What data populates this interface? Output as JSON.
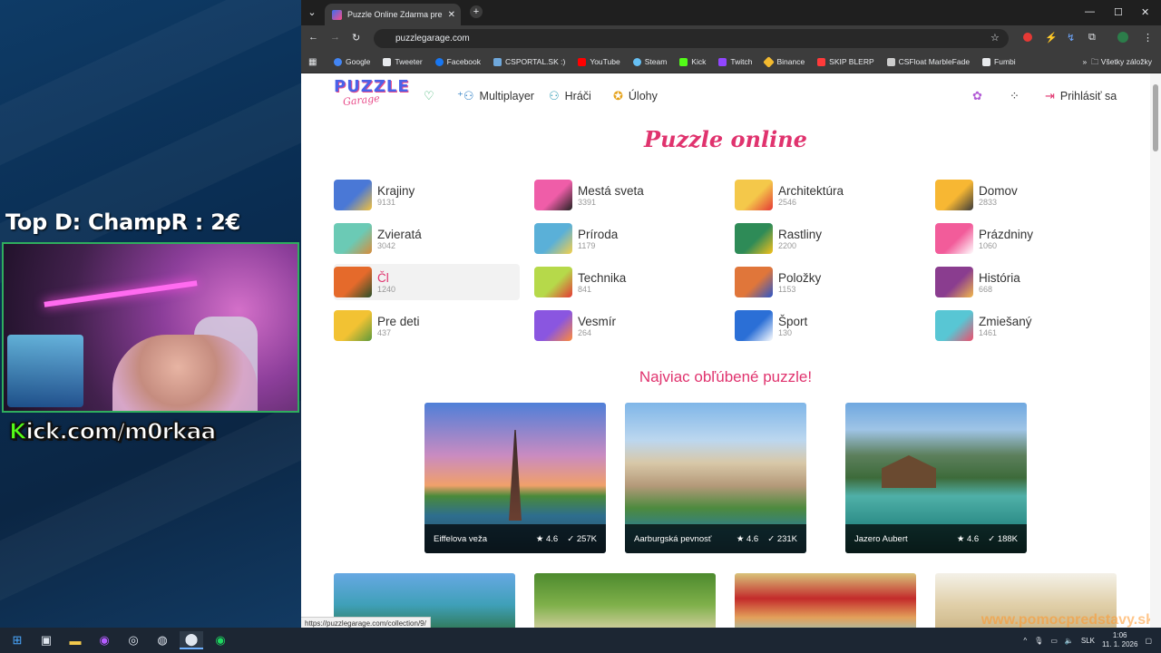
{
  "stream": {
    "donation_text": "Top D: ChampR : 2€",
    "kick_prefix": "K",
    "kick_rest": "ick.com/m0rkaa"
  },
  "browser": {
    "tab_title": "Puzzle Online Zdarma pre Dospelých",
    "url": "puzzlegarage.com",
    "bookmarks": [
      {
        "label": "Google",
        "color": "#4285f4"
      },
      {
        "label": "Tweeter",
        "color": "#e8eaed"
      },
      {
        "label": "Facebook",
        "color": "#1877f2"
      },
      {
        "label": "CSPORTAL.SK :)",
        "color": "#6fa8dc"
      },
      {
        "label": "YouTube",
        "color": "#ff0000"
      },
      {
        "label": "Steam",
        "color": "#66c0f4"
      },
      {
        "label": "Kick",
        "color": "#53fc18"
      },
      {
        "label": "Twitch",
        "color": "#9146ff"
      },
      {
        "label": "Binance",
        "color": "#f3ba2f"
      },
      {
        "label": "SKIP BLERP",
        "color": "#ff3a3a"
      },
      {
        "label": "CSFloat MarbleFade",
        "color": "#cccccc"
      },
      {
        "label": "Fumbi",
        "color": "#e8eaed"
      }
    ],
    "all_bookmarks": "Všetky záložky",
    "status_url": "https://puzzlegarage.com/collection/9/"
  },
  "site": {
    "logo_top": "PUZZLE",
    "logo_bottom": "Garage",
    "nav": {
      "multiplayer": "Multiplayer",
      "players": "Hráči",
      "tasks": "Úlohy",
      "login": "Prihlásiť sa"
    },
    "title": "Puzzle online",
    "categories": [
      {
        "name": "Krajiny",
        "count": "9131",
        "c1": "#4a78d6",
        "c2": "#f4c23b"
      },
      {
        "name": "Mestá sveta",
        "count": "3391",
        "c1": "#ef5da8",
        "c2": "#222"
      },
      {
        "name": "Architektúra",
        "count": "2546",
        "c1": "#f4c84a",
        "c2": "#e53935"
      },
      {
        "name": "Domov",
        "count": "2833",
        "c1": "#f7b733",
        "c2": "#3b3b3b"
      },
      {
        "name": "Zvieratá",
        "count": "3042",
        "c1": "#6bcab5",
        "c2": "#d98c3a"
      },
      {
        "name": "Príroda",
        "count": "1179",
        "c1": "#5ab0d8",
        "c2": "#f5d04a"
      },
      {
        "name": "Rastliny",
        "count": "2200",
        "c1": "#2e8b57",
        "c2": "#f7c11a"
      },
      {
        "name": "Prázdniny",
        "count": "1060",
        "c1": "#f25c9a",
        "c2": "#ffffff"
      },
      {
        "name": "Čl",
        "count": "1240",
        "c1": "#e56a2b",
        "c2": "#2a4f2a"
      },
      {
        "name": "Technika",
        "count": "841",
        "c1": "#b6d94a",
        "c2": "#e53935"
      },
      {
        "name": "Položky",
        "count": "1153",
        "c1": "#e0763a",
        "c2": "#2b55c9"
      },
      {
        "name": "História",
        "count": "668",
        "c1": "#8a3d8f",
        "c2": "#f2b84b"
      },
      {
        "name": "Pre deti",
        "count": "437",
        "c1": "#f2c233",
        "c2": "#5e9a3b"
      },
      {
        "name": "Vesmír",
        "count": "264",
        "c1": "#8a56e0",
        "c2": "#ff8a3a"
      },
      {
        "name": "Šport",
        "count": "130",
        "c1": "#2b6fd6",
        "c2": "#ffffff"
      },
      {
        "name": "Zmiešaný",
        "count": "1461",
        "c1": "#58c6d4",
        "c2": "#ef4d6b"
      }
    ],
    "popular_title": "Najviac obľúbené puzzle!",
    "popular": [
      {
        "name": "Eiffelova veža",
        "rating": "4.6",
        "count": "257K"
      },
      {
        "name": "Aarburgská pevnosť",
        "rating": "4.6",
        "count": "231K"
      },
      {
        "name": "Jazero Aubert",
        "rating": "4.6",
        "count": "188K"
      }
    ],
    "watermark": "www.pomocpredstavy.sk"
  },
  "taskbar": {
    "lang": "SLK",
    "time": "1:06",
    "date": "11. 1. 2026"
  }
}
